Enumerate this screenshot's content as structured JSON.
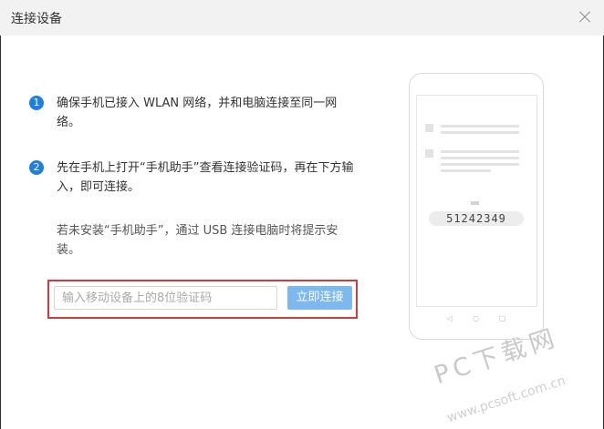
{
  "window": {
    "title": "连接设备"
  },
  "steps": [
    {
      "num": "1",
      "text": "确保手机已接入 WLAN 网络，并和电脑连接至同一网络。"
    },
    {
      "num": "2",
      "text": "先在手机上打开“手机助手”查看连接验证码，再在下方输入，即可连接。"
    }
  ],
  "note": "若未安装“手机助手”，通过 USB 连接电脑时将提示安装。",
  "form": {
    "placeholder": "输入移动设备上的8位验证码",
    "button_label": "立即连接"
  },
  "phone": {
    "code": "51242349",
    "nav_icons": [
      "back-icon",
      "home-icon",
      "recents-icon"
    ]
  },
  "watermark": {
    "main": "PC下载网",
    "url": "www.pcsoft.com.cn"
  },
  "colors": {
    "accent": "#1e7fe0",
    "button": "#7db8ef",
    "highlight_frame": "#d23b3b"
  }
}
